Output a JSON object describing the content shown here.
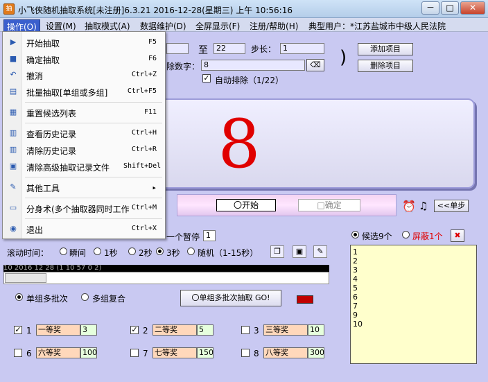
{
  "window": {
    "title": "小飞侠随机抽取系统[未注册]6.3.21 2016-12-28(星期三) 上午 10:56:16",
    "app_icon": "抽",
    "minimize": "－",
    "maximize": "□",
    "close": "✕"
  },
  "menubar": {
    "items": [
      "操作(O)",
      "设置(M)",
      "抽取模式(A)",
      "数据维护(D)",
      "全屏显示(F)",
      "注册/帮助(H)"
    ],
    "user_label": "典型用户：*江苏盐城市中级人民法院"
  },
  "dropdown": {
    "items": [
      {
        "label": "开始抽取",
        "shortcut": "F5",
        "icon": "▶"
      },
      {
        "label": "确定抽取",
        "shortcut": "F6",
        "icon": "■"
      },
      {
        "label": "撤消",
        "shortcut": "Ctrl+Z",
        "icon": "↶"
      },
      {
        "label": "批量抽取[单组或多组]",
        "shortcut": "Ctrl+F5",
        "icon": "▤"
      },
      {
        "label": "重置候选列表",
        "shortcut": "F11",
        "icon": "▦"
      },
      {
        "label": "查看历史记录",
        "shortcut": "Ctrl+H",
        "icon": "▥"
      },
      {
        "label": "清除历史记录",
        "shortcut": "Ctrl+R",
        "icon": "▥"
      },
      {
        "label": "清除高级抽取记录文件",
        "shortcut": "Shift+Del",
        "icon": "▣"
      },
      {
        "label": "其他工具",
        "shortcut": "",
        "icon": "✎",
        "arrow": "▸"
      },
      {
        "label": "分身术(多个抽取器同时工作",
        "shortcut": "Ctrl+M",
        "icon": "▭"
      },
      {
        "label": "退出",
        "shortcut": "Ctrl+X",
        "icon": "◉"
      }
    ]
  },
  "range": {
    "to_label": "至",
    "to_value": "22",
    "step_label": "步长：",
    "step_value": "1",
    "exclude_label": "除数字：",
    "exclude_value": "8",
    "auto_exclude_label": "自动排除（1/22）",
    "paren": ")"
  },
  "buttons": {
    "add_item": "添加项目",
    "delete_item": "删除项目",
    "start": "〇开始",
    "confirm": "□确定",
    "single_step": "<<单步",
    "batch_go": "〇单组多批次抽取 GO!"
  },
  "display": {
    "number": "8"
  },
  "pause": {
    "label": "一个暂停",
    "value": "1"
  },
  "scroll_time": {
    "label": "滚动时间：",
    "options": [
      "瞬间",
      "1秒",
      "2秒",
      "3秒",
      "随机（1-15秒）"
    ],
    "selected": 3
  },
  "ticker": {
    "text": "10 2016 12 28 (1 10 57 0 2)"
  },
  "mode": {
    "options": [
      "单组多批次",
      "多组复合"
    ],
    "selected": 0
  },
  "candidates": {
    "options": [
      "候选9个",
      "屏蔽1个"
    ],
    "selected": 0,
    "list": [
      "1",
      "2",
      "3",
      "4",
      "5",
      "6",
      "7",
      "9",
      "10"
    ]
  },
  "prizes": [
    {
      "idx": "1",
      "name": "一等奖",
      "count": "3",
      "checked": true
    },
    {
      "idx": "2",
      "name": "二等奖",
      "count": "5",
      "checked": true
    },
    {
      "idx": "3",
      "name": "三等奖",
      "count": "10",
      "checked": false
    },
    {
      "idx": "6",
      "name": "六等奖",
      "count": "100",
      "checked": false
    },
    {
      "idx": "7",
      "name": "七等奖",
      "count": "150",
      "checked": false
    },
    {
      "idx": "8",
      "name": "八等奖",
      "count": "300",
      "checked": false
    }
  ],
  "colors": {
    "display_number": "#e00000",
    "hidden_text": "#e00000",
    "menu_active": "#3a5fcd",
    "list_bg": "#ffffcc"
  }
}
